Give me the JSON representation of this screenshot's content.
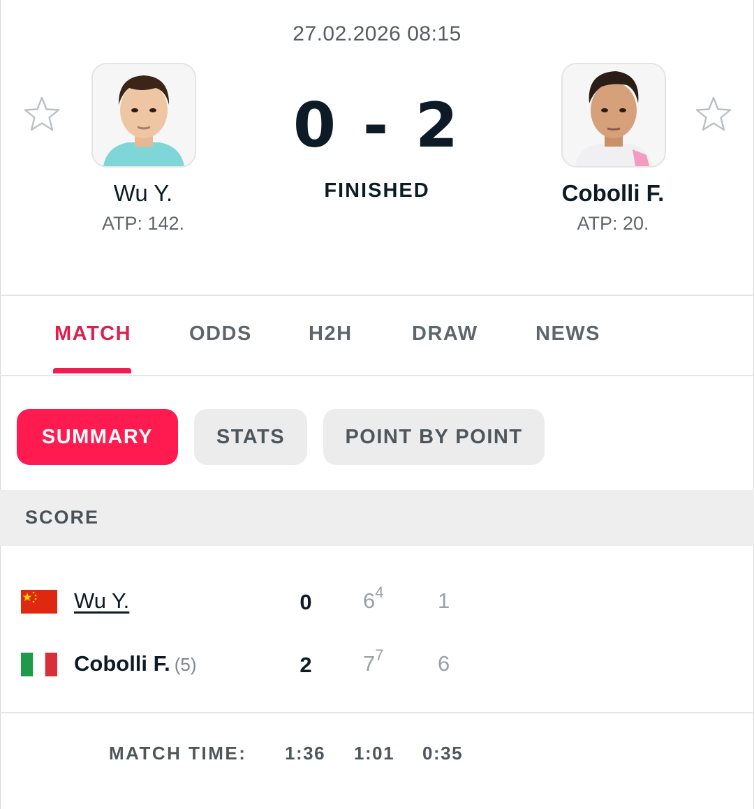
{
  "match": {
    "datetime": "27.02.2026 08:15",
    "score": "0 - 2",
    "status": "FINISHED"
  },
  "players": {
    "home": {
      "name": "Wu Y.",
      "rank": "ATP: 142."
    },
    "away": {
      "name": "Cobolli F.",
      "rank": "ATP: 20."
    }
  },
  "tabs": [
    "MATCH",
    "ODDS",
    "H2H",
    "DRAW",
    "NEWS"
  ],
  "active_tab": "MATCH",
  "subtabs": [
    "SUMMARY",
    "STATS",
    "POINT BY POINT"
  ],
  "active_subtab": "SUMMARY",
  "score_section": {
    "title": "SCORE",
    "rows": [
      {
        "name": "Wu Y.",
        "seed": "",
        "flag": "china-flag",
        "sets_won": "0",
        "set1": "6",
        "set1_tb": "4",
        "set2": "1"
      },
      {
        "name": "Cobolli F.",
        "seed": "(5)",
        "flag": "italy-flag",
        "sets_won": "2",
        "set1": "7",
        "set1_tb": "7",
        "set2": "6"
      }
    ],
    "match_time_label": "MATCH TIME:",
    "match_time": [
      "1:36",
      "1:01",
      "0:35"
    ]
  },
  "colors": {
    "accent": "#ff1a4f",
    "accent_text": "#dd1f4c",
    "text_dark": "#0c1b26",
    "text_muted": "#5f666b"
  }
}
